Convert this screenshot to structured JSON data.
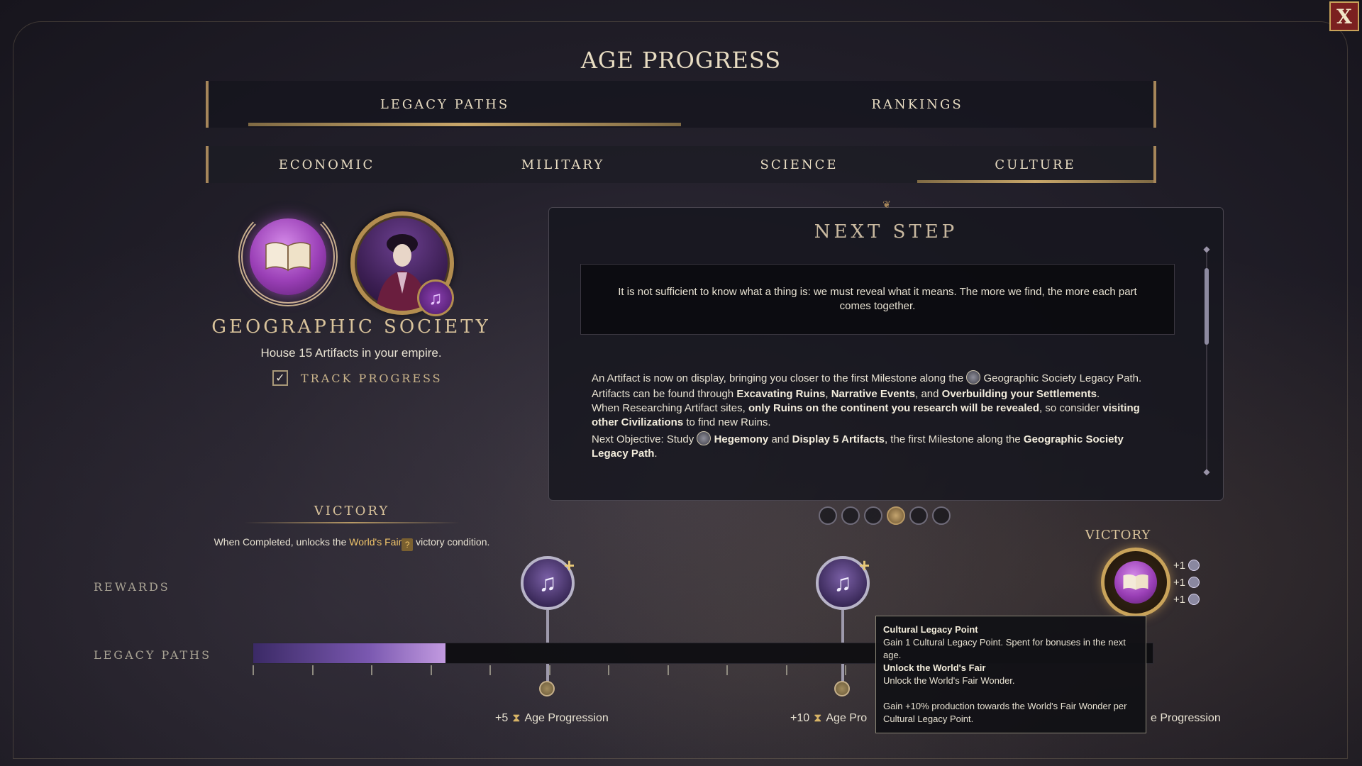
{
  "header": {
    "title": "AGE PROGRESS",
    "close_label": "X"
  },
  "main_tabs": [
    {
      "label": "LEGACY PATHS",
      "active": true
    },
    {
      "label": "RANKINGS",
      "active": false
    }
  ],
  "sub_tabs": [
    {
      "label": "ECONOMIC",
      "active": false
    },
    {
      "label": "MILITARY",
      "active": false
    },
    {
      "label": "SCIENCE",
      "active": false
    },
    {
      "label": "CULTURE",
      "active": true
    }
  ],
  "legacy_path": {
    "name": "GEOGRAPHIC SOCIETY",
    "description": "House 15 Artifacts in your empire.",
    "track_label": "TRACK PROGRESS",
    "track_checked": true,
    "emblem_icon": "open-book-icon",
    "badge_icon": "music-note-icon"
  },
  "next_step": {
    "title": "NEXT STEP",
    "quote": "It is not sufficient to know what a thing is: we must reveal what it means. The more we find, the more each part comes together.",
    "para1_a": "An Artifact is now on display, bringing you closer to the first Milestone along the",
    "para1_b": "Geographic Society Legacy Path.",
    "para2_a": "Artifacts can be found through",
    "para2_b1": "Excavating Ruins",
    "para2_sep1": ",",
    "para2_b2": "Narrative Events",
    "para2_sep2": ", and",
    "para2_b3": "Overbuilding your Settlements",
    "para2_end": ".",
    "para3_a": "When Researching Artifact sites,",
    "para3_b1": "only Ruins on the continent you research will be revealed",
    "para3_c": ", so consider",
    "para3_b2": "visiting other Civilizations",
    "para3_d": "to find new Ruins.",
    "para4_a": "Next Objective: Study",
    "para4_b1": "Hegemony",
    "para4_c": "and",
    "para4_b2": "Display 5 Artifacts",
    "para4_d": ", the first Milestone along the",
    "para4_b3": "Geographic Society Legacy Path",
    "para4_end": "."
  },
  "pager": {
    "count": 6,
    "active_index": 3
  },
  "victory_left": {
    "title": "VICTORY",
    "text_a": "When Completed, unlocks the",
    "world_fair": "World's Fair",
    "text_b": "victory condition.",
    "q_glyph": "?"
  },
  "rows": {
    "rewards_label": "REWARDS",
    "legacy_paths_label": "LEGACY PATHS"
  },
  "progress": {
    "fraction": 0.214,
    "ticks": 11
  },
  "milestones": [
    {
      "age_amount": "+5",
      "age_text": "Age Progression",
      "reward_icon": "cultural-legacy-point-icon"
    },
    {
      "age_amount": "+10",
      "age_text": "Age Pro",
      "reward_icon": "cultural-legacy-point-icon"
    },
    {
      "age_amount": "",
      "age_text": "e Progression",
      "reward_icon": "victory-medal-icon"
    }
  ],
  "victory_right": {
    "title": "VICTORY",
    "bonuses": [
      "+1",
      "+1",
      "+1"
    ]
  },
  "tooltip": {
    "h1": "Cultural Legacy Point",
    "t1": "Gain 1 Cultural Legacy Point. Spent for bonuses in the next age.",
    "h2": "Unlock the World's Fair",
    "t2": "Unlock the World's Fair Wonder.",
    "t3": "Gain +10% production towards the World's Fair Wonder per Cultural Legacy Point."
  },
  "glyphs": {
    "music": "♫",
    "plus": "+",
    "check": "✓",
    "hourglass": "⧗",
    "book": "📖"
  },
  "colors": {
    "accent_gold": "#c9a76a",
    "culture_purple": "#9a3fb6",
    "close_red": "#7b2020"
  }
}
